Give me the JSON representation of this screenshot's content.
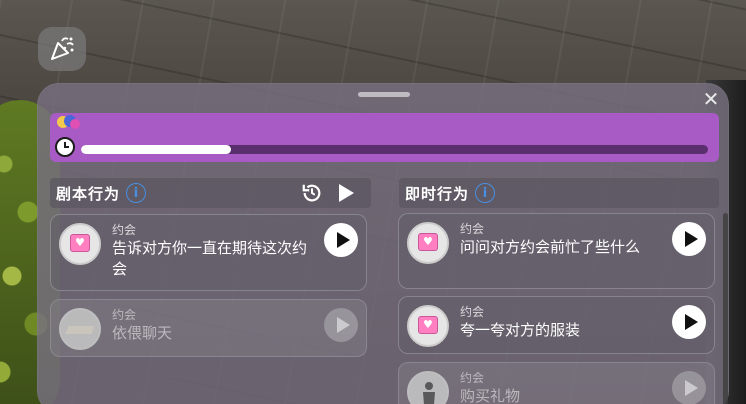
{
  "progress": {
    "value": 0.24
  },
  "script_section": {
    "title": "剧本行为"
  },
  "instant_section": {
    "title": "即时行为"
  },
  "info_glyph": "i",
  "script_cards": [
    {
      "category": "约会",
      "text": "告诉对方你一直在期待这次约会",
      "disabled": false
    },
    {
      "category": "约会",
      "text": "依偎聊天",
      "disabled": true
    }
  ],
  "instant_cards": [
    {
      "category": "约会",
      "text": "问问对方约会前忙了些什么",
      "disabled": false
    },
    {
      "category": "约会",
      "text": "夸一夸对方的服装",
      "disabled": false
    },
    {
      "category": "约会",
      "text": "购买礼物",
      "disabled": true
    }
  ],
  "close_glyph": "✕",
  "colors": {
    "progress_bar": "#a85bc4",
    "progress_track": "#5a2f6e",
    "info_icon": "#4a8fe0"
  },
  "icons": {
    "party": "party-popper-icon",
    "clock": "clock-icon",
    "balloons": "balloons-icon",
    "history": "history-icon",
    "play": "play-icon",
    "chat_calendar": "chat-calendar-icon",
    "person": "person-icon"
  }
}
